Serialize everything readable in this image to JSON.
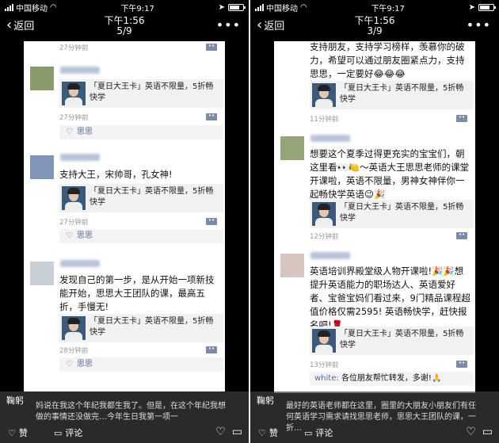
{
  "left": {
    "status": {
      "carrier": "中国移动",
      "time": "下午9:17"
    },
    "nav": {
      "back_label": "返回",
      "time": "下午1:56",
      "page": "5/9"
    },
    "card_text": "「夏日大王卡」英语不限量，5折畅快学",
    "top_time": "27分钟前",
    "posts": [
      {
        "time": "27分钟前",
        "likes": "思思"
      },
      {
        "text": "支持大王，宋帅哥，孔女神!",
        "time": "27分钟前",
        "likes": "思思"
      },
      {
        "text": "发现自己的第一步，是从开始一项新技能开始，思思大王团队的课，最高五折，手慢无!",
        "time": "28分钟前",
        "likes": "思思"
      }
    ],
    "overlay": {
      "name": "鞠躬",
      "text": "妈说在我这个年纪我都生我了。但是，在这个年纪我想做的事情还没做完…今年生日我第一项一"
    }
  },
  "right": {
    "status": {
      "carrier": "中国移动",
      "time": "下午9:17"
    },
    "nav": {
      "back_label": "返回",
      "time": "下午1:56",
      "page": "3/9"
    },
    "card_text": "「夏日大王卡」英语不限量，5折畅快学",
    "top_text": "支持朋友，支持学习榜样，羡慕你的破力，希望可以通过朋友圈紧点力，支持思思，一定要好😂😂😂",
    "posts": [
      {
        "time": "11分钟前"
      },
      {
        "text": "想要这个夏季过得更充实的宝宝们，朝这里看👀🍋～英语大王思思老师的课堂开课啦，英语不限量，男神女神伴你一起畅快学英语😉🎉",
        "time": "12分钟前"
      },
      {
        "text": "英语培训界殿堂级人物开课啦!🎉🎉想提升英语能力的职场达人、英语爱好者、宝爸宝妈们看过来，9门精品课程超值价格仅需2595! 英语畅快学，赶快报名吧!🌹",
        "time": "13分钟前",
        "comment_author": "white:",
        "comment_text": "各位朋友帮忙转发，多谢!🙏"
      }
    ],
    "overlay": {
      "name": "鞠躬",
      "text": "最好的英语老师都在这里，圈里的大朋友小朋友们有任何英语学习需求请找思思老师，思思大王团队的课，一折…"
    }
  },
  "bottom": {
    "like_label": "赞",
    "comment_label": "评论"
  }
}
